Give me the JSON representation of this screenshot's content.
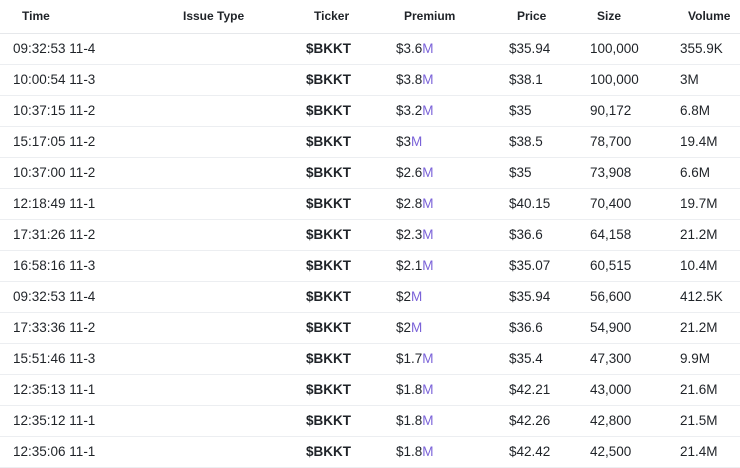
{
  "columns": {
    "time": "Time",
    "issue_type": "Issue Type",
    "ticker": "Ticker",
    "premium": "Premium",
    "price": "Price",
    "size": "Size",
    "volume": "Volume"
  },
  "colors": {
    "ticker": "#3b55d9",
    "premium_suffix": "#7a62d8",
    "text": "#1f2328",
    "divider": "#eceef1"
  },
  "rows": [
    {
      "time": "09:32:53 11-4",
      "issue_type": "",
      "ticker": "$BKKT",
      "premium_value": "$3.6",
      "premium_suffix": "M",
      "price": "$35.94",
      "size": "100,000",
      "volume": "355.9K"
    },
    {
      "time": "10:00:54 11-3",
      "issue_type": "",
      "ticker": "$BKKT",
      "premium_value": "$3.8",
      "premium_suffix": "M",
      "price": "$38.1",
      "size": "100,000",
      "volume": "3M"
    },
    {
      "time": "10:37:15 11-2",
      "issue_type": "",
      "ticker": "$BKKT",
      "premium_value": "$3.2",
      "premium_suffix": "M",
      "price": "$35",
      "size": "90,172",
      "volume": "6.8M"
    },
    {
      "time": "15:17:05 11-2",
      "issue_type": "",
      "ticker": "$BKKT",
      "premium_value": "$3",
      "premium_suffix": "M",
      "price": "$38.5",
      "size": "78,700",
      "volume": "19.4M"
    },
    {
      "time": "10:37:00 11-2",
      "issue_type": "",
      "ticker": "$BKKT",
      "premium_value": "$2.6",
      "premium_suffix": "M",
      "price": "$35",
      "size": "73,908",
      "volume": "6.6M"
    },
    {
      "time": "12:18:49 11-1",
      "issue_type": "",
      "ticker": "$BKKT",
      "premium_value": "$2.8",
      "premium_suffix": "M",
      "price": "$40.15",
      "size": "70,400",
      "volume": "19.7M"
    },
    {
      "time": "17:31:26 11-2",
      "issue_type": "",
      "ticker": "$BKKT",
      "premium_value": "$2.3",
      "premium_suffix": "M",
      "price": "$36.6",
      "size": "64,158",
      "volume": "21.2M"
    },
    {
      "time": "16:58:16 11-3",
      "issue_type": "",
      "ticker": "$BKKT",
      "premium_value": "$2.1",
      "premium_suffix": "M",
      "price": "$35.07",
      "size": "60,515",
      "volume": "10.4M"
    },
    {
      "time": "09:32:53 11-4",
      "issue_type": "",
      "ticker": "$BKKT",
      "premium_value": "$2",
      "premium_suffix": "M",
      "price": "$35.94",
      "size": "56,600",
      "volume": "412.5K"
    },
    {
      "time": "17:33:36 11-2",
      "issue_type": "",
      "ticker": "$BKKT",
      "premium_value": "$2",
      "premium_suffix": "M",
      "price": "$36.6",
      "size": "54,900",
      "volume": "21.2M"
    },
    {
      "time": "15:51:46 11-3",
      "issue_type": "",
      "ticker": "$BKKT",
      "premium_value": "$1.7",
      "premium_suffix": "M",
      "price": "$35.4",
      "size": "47,300",
      "volume": "9.9M"
    },
    {
      "time": "12:35:13 11-1",
      "issue_type": "",
      "ticker": "$BKKT",
      "premium_value": "$1.8",
      "premium_suffix": "M",
      "price": "$42.21",
      "size": "43,000",
      "volume": "21.6M"
    },
    {
      "time": "12:35:12 11-1",
      "issue_type": "",
      "ticker": "$BKKT",
      "premium_value": "$1.8",
      "premium_suffix": "M",
      "price": "$42.26",
      "size": "42,800",
      "volume": "21.5M"
    },
    {
      "time": "12:35:06 11-1",
      "issue_type": "",
      "ticker": "$BKKT",
      "premium_value": "$1.8",
      "premium_suffix": "M",
      "price": "$42.42",
      "size": "42,500",
      "volume": "21.4M"
    }
  ]
}
